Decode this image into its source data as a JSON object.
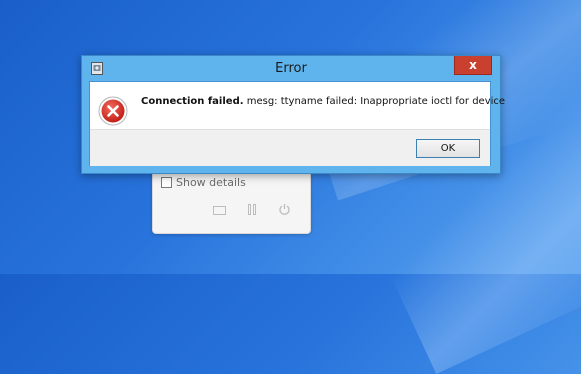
{
  "dialog": {
    "title": "Error",
    "close_glyph": "x",
    "message_bold": "Connection failed.",
    "message_rest": " mesg: ttyname failed: Inappropriate ioctl for device",
    "ok_label": "OK",
    "icon": "error-icon"
  },
  "background_panel": {
    "show_details_label": "Show details",
    "show_details_checked": false,
    "icons": [
      "folder-icon",
      "pause-icon",
      "power-icon"
    ]
  },
  "colors": {
    "titlebar": "#5fb4ee",
    "close_button": "#c9402f",
    "error_icon": "#d32f2f"
  }
}
